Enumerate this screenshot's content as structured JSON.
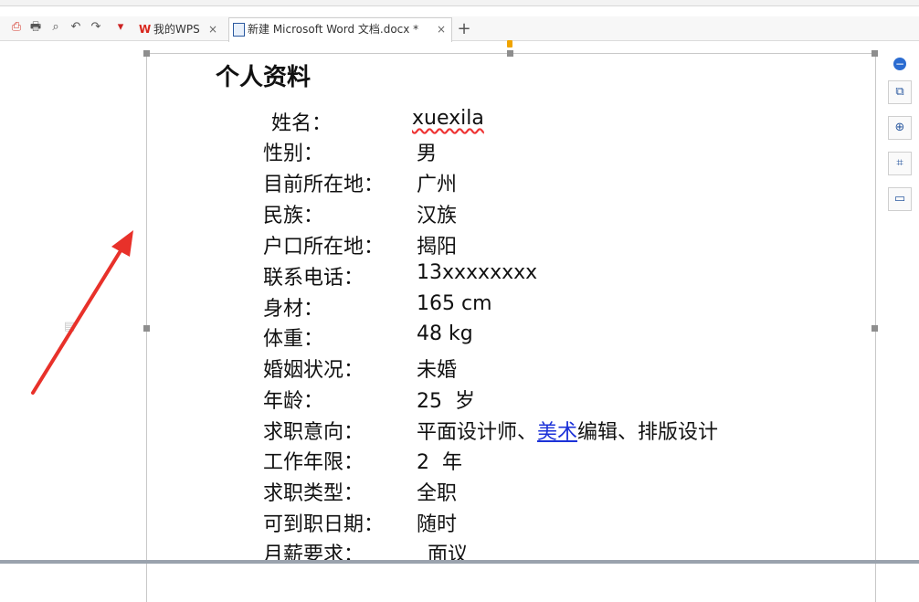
{
  "tabs": [
    {
      "label": "我的WPS",
      "close": "×"
    },
    {
      "label": "新建 Microsoft Word 文档.docx *",
      "close": "×"
    }
  ],
  "new_tab_label": "+",
  "document": {
    "title": "个人资料",
    "fields": [
      {
        "label": "姓名：",
        "value": "xuexila"
      },
      {
        "label": "性别：",
        "value": "男"
      },
      {
        "label": "目前所在地：",
        "value": "广州"
      },
      {
        "label": "民族：",
        "value": "汉族"
      },
      {
        "label": "户口所在地：",
        "value": "揭阳"
      },
      {
        "label": "联系电话：",
        "value": "13xxxxxxxx"
      },
      {
        "label": "身材：",
        "value": "165 cm"
      },
      {
        "label": "体重：",
        "value": "48 kg"
      },
      {
        "label": "婚姻状况：",
        "value": "未婚"
      },
      {
        "label": "年龄：",
        "value": "25  岁"
      },
      {
        "label": "求职意向：",
        "value_pre": "平面设计师、",
        "value_link": "美术",
        "value_post": "编辑、排版设计"
      },
      {
        "label": "工作年限：",
        "value": "2  年"
      },
      {
        "label": "求职类型：",
        "value": "全职"
      },
      {
        "label": "可到职日期：",
        "value": "随时"
      },
      {
        "label": "月薪要求：",
        "value": "面议"
      }
    ]
  },
  "icons": {
    "toolbar": [
      "pdf-icon",
      "print-icon",
      "print-preview-icon",
      "undo-icon",
      "redo-icon",
      "dropdown-arrow-icon"
    ],
    "sidebar": [
      "minus-icon",
      "style-icon",
      "zoom-icon",
      "crop-icon",
      "record-icon"
    ]
  },
  "colors": {
    "link": "#1c32d8",
    "arrow": "#e8312a",
    "spell_squiggle": "#e33"
  }
}
